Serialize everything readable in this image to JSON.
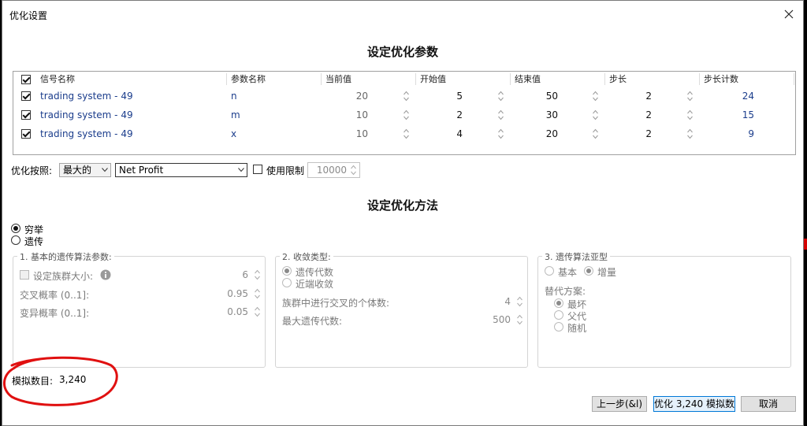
{
  "window": {
    "title": "优化设置"
  },
  "section1": {
    "heading": "设定优化参数"
  },
  "grid": {
    "headers": [
      "信号名称",
      "参数名称",
      "当前值",
      "开始值",
      "结束值",
      "步长",
      "步长计数"
    ],
    "rows": [
      {
        "signal": "trading system - 49",
        "param": "n",
        "current": "20",
        "start": "5",
        "end": "50",
        "step": "2",
        "count": "24"
      },
      {
        "signal": "trading system - 49",
        "param": "m",
        "current": "10",
        "start": "2",
        "end": "30",
        "step": "2",
        "count": "15"
      },
      {
        "signal": "trading system - 49",
        "param": "x",
        "current": "10",
        "start": "4",
        "end": "20",
        "step": "2",
        "count": "9"
      }
    ]
  },
  "optimize": {
    "label": "优化按照:",
    "direction": "最大的",
    "metric": "Net Profit",
    "limit_label": "使用限制",
    "limit_value": "10000"
  },
  "section2": {
    "heading": "设定优化方法"
  },
  "method": {
    "exhaustive": "穷举",
    "genetic": "遗传"
  },
  "group1": {
    "title": "1. 基本的遗传算法参数:",
    "population_label": "设定族群大小:",
    "population_value": "6",
    "crossover_label": "交叉概率 (0..1]:",
    "crossover_value": "0.95",
    "mutation_label": "变异概率 (0..1]:",
    "mutation_value": "0.05"
  },
  "group2": {
    "title": "2. 收敛类型:",
    "opt_generations": "遗传代数",
    "opt_converge": "近端收敛",
    "cross_label": "族群中进行交叉的个体数:",
    "cross_value": "4",
    "max_gen_label": "最大遗传代数:",
    "max_gen_value": "500"
  },
  "group3": {
    "title": "3. 遗传算法亚型",
    "opt_basic": "基本",
    "opt_incremental": "增量",
    "replace_label": "替代方案:",
    "opt_worst": "最坏",
    "opt_parent": "父代",
    "opt_random": "随机"
  },
  "simulations": {
    "label": "模拟数目:",
    "value": "3,240"
  },
  "buttons": {
    "back": "上一步(&l)",
    "run": "优化 3,240 模拟数",
    "cancel": "取消"
  }
}
